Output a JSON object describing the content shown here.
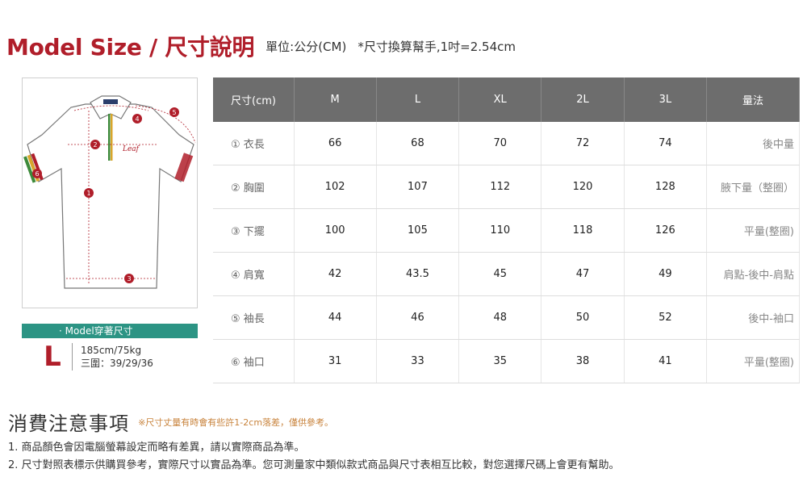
{
  "header": {
    "title": "Model Size / 尺寸說明",
    "unit": "單位:公分(CM)",
    "note": "*尺寸換算幫手,1吋=2.54cm"
  },
  "diagram": {
    "markers": [
      "1",
      "2",
      "3",
      "4",
      "5",
      "6"
    ],
    "colors": {
      "marker": "#b01e2a",
      "outline": "#777777",
      "stripe_green": "#3d8a3a",
      "stripe_gold": "#d9a62b",
      "stripe_red": "#b01e2a"
    }
  },
  "model": {
    "tag": "· Model穿著尺寸",
    "size": "L",
    "height_weight": "185cm/75kg",
    "measurements": "三圍：39/29/36"
  },
  "table": {
    "headers": [
      "尺寸(cm)",
      "M",
      "L",
      "XL",
      "2L",
      "3L",
      "量法"
    ],
    "rows": [
      {
        "label": "① 衣長",
        "values": [
          "66",
          "68",
          "70",
          "72",
          "74"
        ],
        "method": "後中量"
      },
      {
        "label": "② 胸圍",
        "values": [
          "102",
          "107",
          "112",
          "120",
          "128"
        ],
        "method": "腋下量（整圈）"
      },
      {
        "label": "③ 下擺",
        "values": [
          "100",
          "105",
          "110",
          "118",
          "126"
        ],
        "method": "平量(整圈)"
      },
      {
        "label": "④ 肩寬",
        "values": [
          "42",
          "43.5",
          "45",
          "47",
          "49"
        ],
        "method": "肩點-後中-肩點"
      },
      {
        "label": "⑤ 袖長",
        "values": [
          "44",
          "46",
          "48",
          "50",
          "52"
        ],
        "method": "後中-袖口"
      },
      {
        "label": "⑥ 袖口",
        "values": [
          "31",
          "33",
          "35",
          "38",
          "41"
        ],
        "method": "平量(整圈)"
      }
    ]
  },
  "notice": {
    "title": "消費注意事項",
    "subtitle": "※尺寸丈量有時會有些許1-2cm落差，僅供參考。",
    "items": [
      "1. 商品顏色會因電腦螢幕設定而略有差異，請以實際商品為準。",
      "2. 尺寸對照表標示供購買參考，實際尺寸以實品為準。您可測量家中類似款式商品與尺寸表相互比較，對您選擇尺碼上會更有幫助。"
    ]
  },
  "colors": {
    "accent": "#b01e2a",
    "teal": "#2c9484",
    "header_gray": "#6d6d6d"
  }
}
